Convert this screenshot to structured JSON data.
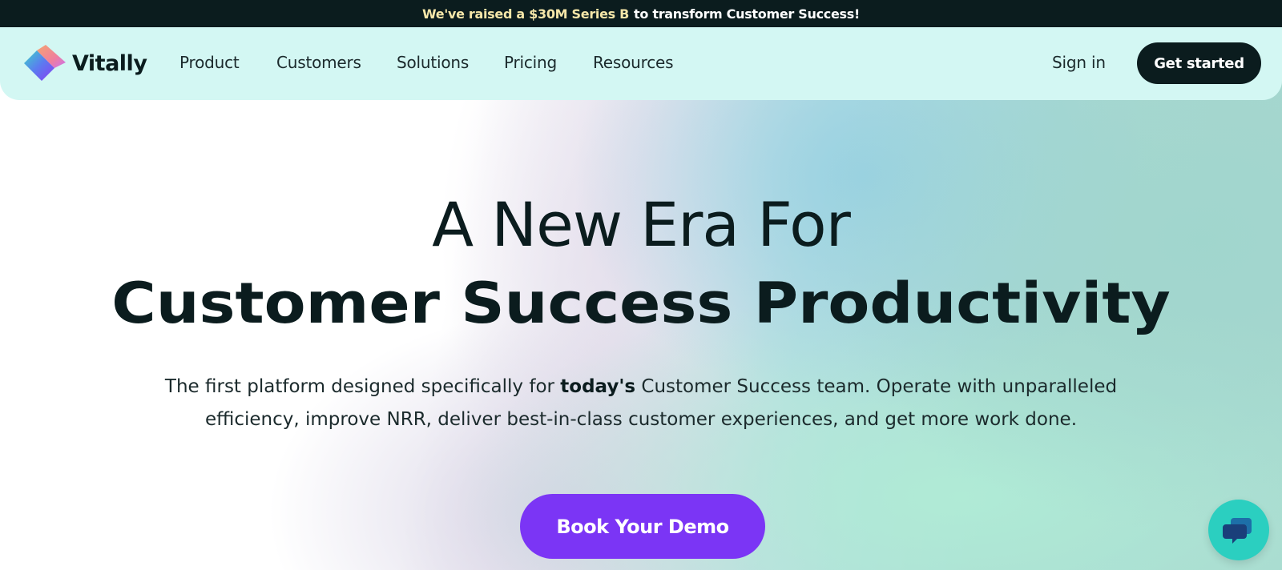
{
  "announcement": {
    "highlight": "We've raised a $30M Series B",
    "rest": "to transform Customer Success!"
  },
  "nav": {
    "brand": "Vitally",
    "links": [
      "Product",
      "Customers",
      "Solutions",
      "Pricing",
      "Resources"
    ],
    "sign_in": "Sign in",
    "cta": "Get started"
  },
  "hero": {
    "line1": "A New Era For",
    "line2": "Customer Success Productivity",
    "sub_before": "The first platform designed specifically for ",
    "sub_bold": "today's",
    "sub_after": " Customer Success team. Operate with unparalleled efficiency, improve NRR, deliver best-in-class customer experiences, and get more work done.",
    "cta": "Book Your Demo"
  },
  "chat_widget": {
    "icon": "chat-bubbles-icon"
  },
  "colors": {
    "announce_bg": "#0b1c1e",
    "announce_highlight": "#f5e6a8",
    "nav_bg": "#d3f7f3",
    "primary_dark": "#0b1c1e",
    "demo_button": "#7b35f5",
    "chat_button": "#2bcfc0"
  }
}
